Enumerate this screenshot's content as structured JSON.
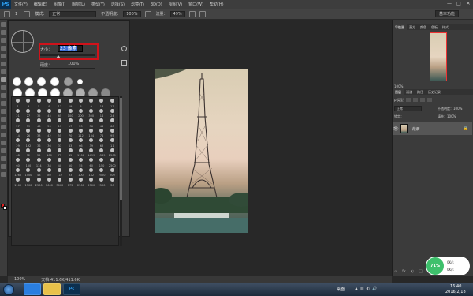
{
  "app": {
    "logo": "Ps"
  },
  "menu": [
    "文件(F)",
    "编辑(E)",
    "图像(I)",
    "图层(L)",
    "类型(Y)",
    "选择(S)",
    "滤镜(T)",
    "3D(D)",
    "视图(V)",
    "窗口(W)",
    "帮助(H)"
  ],
  "window_controls": [
    "—",
    "□",
    "✕"
  ],
  "options": {
    "brush_size": "1",
    "mode_label": "模式：",
    "mode_value": "正常",
    "opacity_label": "不透明度：",
    "opacity_value": "100%",
    "flow_label": "流量：",
    "flow_value": "49%",
    "workspace": "基本功能"
  },
  "brush_panel": {
    "size_label": "大小：",
    "size_value": "23 像素",
    "hardness_label": "硬度：",
    "hardness_value": "100%",
    "presets": [
      "1",
      "3",
      "5",
      "9",
      "13",
      "19",
      "5",
      "9",
      "13",
      "17",
      "45",
      "65",
      "100",
      "200",
      "300"
    ],
    "grid": [
      "1",
      "3",
      "5",
      "9",
      "13",
      "19",
      "5",
      "9",
      "13",
      "17",
      "21",
      "27",
      "35",
      "45",
      "65",
      "100",
      "200",
      "300",
      "14",
      "24",
      "27",
      "39",
      "46",
      "59",
      "11",
      "17",
      "23",
      "36",
      "44",
      "60",
      "14",
      "26",
      "33",
      "42",
      "55",
      "70",
      "112",
      "134",
      "74",
      "95",
      "29",
      "192",
      "36",
      "36",
      "33",
      "63",
      "66",
      "39",
      "63",
      "11",
      "48",
      "32",
      "55",
      "100",
      "75",
      "45",
      "1106",
      "1499",
      "1569",
      "2500",
      "60",
      "150",
      "134",
      "38",
      "40",
      "50",
      "55",
      "60",
      "150",
      "2500",
      "1260",
      "1500",
      "48",
      "80",
      "117",
      "33",
      "100",
      "142",
      "2500",
      "200",
      "1160",
      "1300",
      "2500",
      "2600",
      "3000",
      "175",
      "2500",
      "2500",
      "2500",
      "30"
    ]
  },
  "status": {
    "zoom": "100%",
    "doc": "文档:411.6K/411.6K"
  },
  "right_panel": {
    "nav_tabs": [
      "导航器",
      "直方",
      "颜色",
      "色板",
      "样式"
    ],
    "nav_zoom": "100%",
    "layers_tabs": [
      "图层",
      "通道",
      "路径",
      "历史记录"
    ],
    "layer_kind": "ρ 类型",
    "blend_mode": "正常",
    "opacity_label": "不透明度：",
    "opacity_value": "100%",
    "lock_label": "锁定：",
    "fill_label": "填充：",
    "fill_value": "100%",
    "layer_name": "背景",
    "footer_icons": [
      "∞",
      "fx",
      "◐",
      "□",
      "▢",
      "🗑"
    ]
  },
  "perf": {
    "percent": "71%",
    "up": "0K/s",
    "down": "0K/s"
  },
  "taskbar": {
    "apps": [
      {
        "name": "ie",
        "color": "#2a7ee0"
      },
      {
        "name": "explorer",
        "color": "#e8c14a"
      },
      {
        "name": "photoshop",
        "color": "#0c2f4f"
      }
    ],
    "desktop": "桌面",
    "tray": [
      "▲",
      "▥",
      "◐",
      "🔊"
    ],
    "time": "16:40",
    "date": "2016/2/18"
  }
}
